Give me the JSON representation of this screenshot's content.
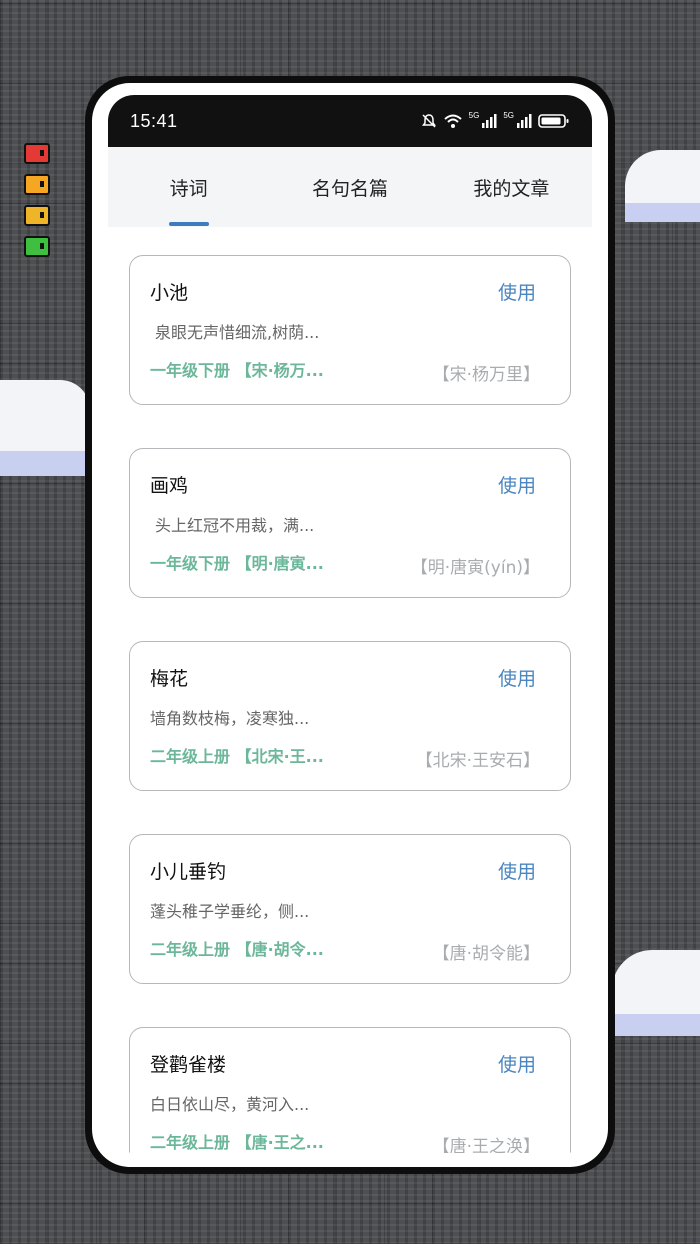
{
  "status_bar": {
    "time": "15:41",
    "signal1": "5G",
    "signal2": "5G"
  },
  "tabs": [
    {
      "label": "诗词",
      "active": true
    },
    {
      "label": "名句名篇",
      "active": false
    },
    {
      "label": "我的文章",
      "active": false
    }
  ],
  "cards": [
    {
      "title": "小池",
      "action": "使用",
      "excerpt": "泉眼无声惜细流,树荫...",
      "meta": "一年级下册 【宋·杨万...",
      "author": "【宋·杨万里】"
    },
    {
      "title": "画鸡",
      "action": "使用",
      "excerpt": "头上红冠不用裁，满...",
      "meta": "一年级下册 【明·唐寅...",
      "author": "【明·唐寅(yín)】"
    },
    {
      "title": "梅花",
      "action": "使用",
      "excerpt": "墙角数枝梅，凌寒独...",
      "meta": "二年级上册 【北宋·王...",
      "author": "【北宋·王安石】"
    },
    {
      "title": "小儿垂钓",
      "action": "使用",
      "excerpt": "蓬头稚子学垂纶，侧...",
      "meta": "二年级上册 【唐·胡令...",
      "author": "【唐·胡令能】"
    },
    {
      "title": "登鹳雀楼",
      "action": "使用",
      "excerpt": "白日依山尽，黄河入...",
      "meta": "二年级上册 【唐·王之...",
      "author": "【唐·王之涣】"
    }
  ],
  "colors": {
    "accent": "#4b86c0",
    "meta_green": "#6cb79a",
    "muted": "#a9acaf"
  }
}
